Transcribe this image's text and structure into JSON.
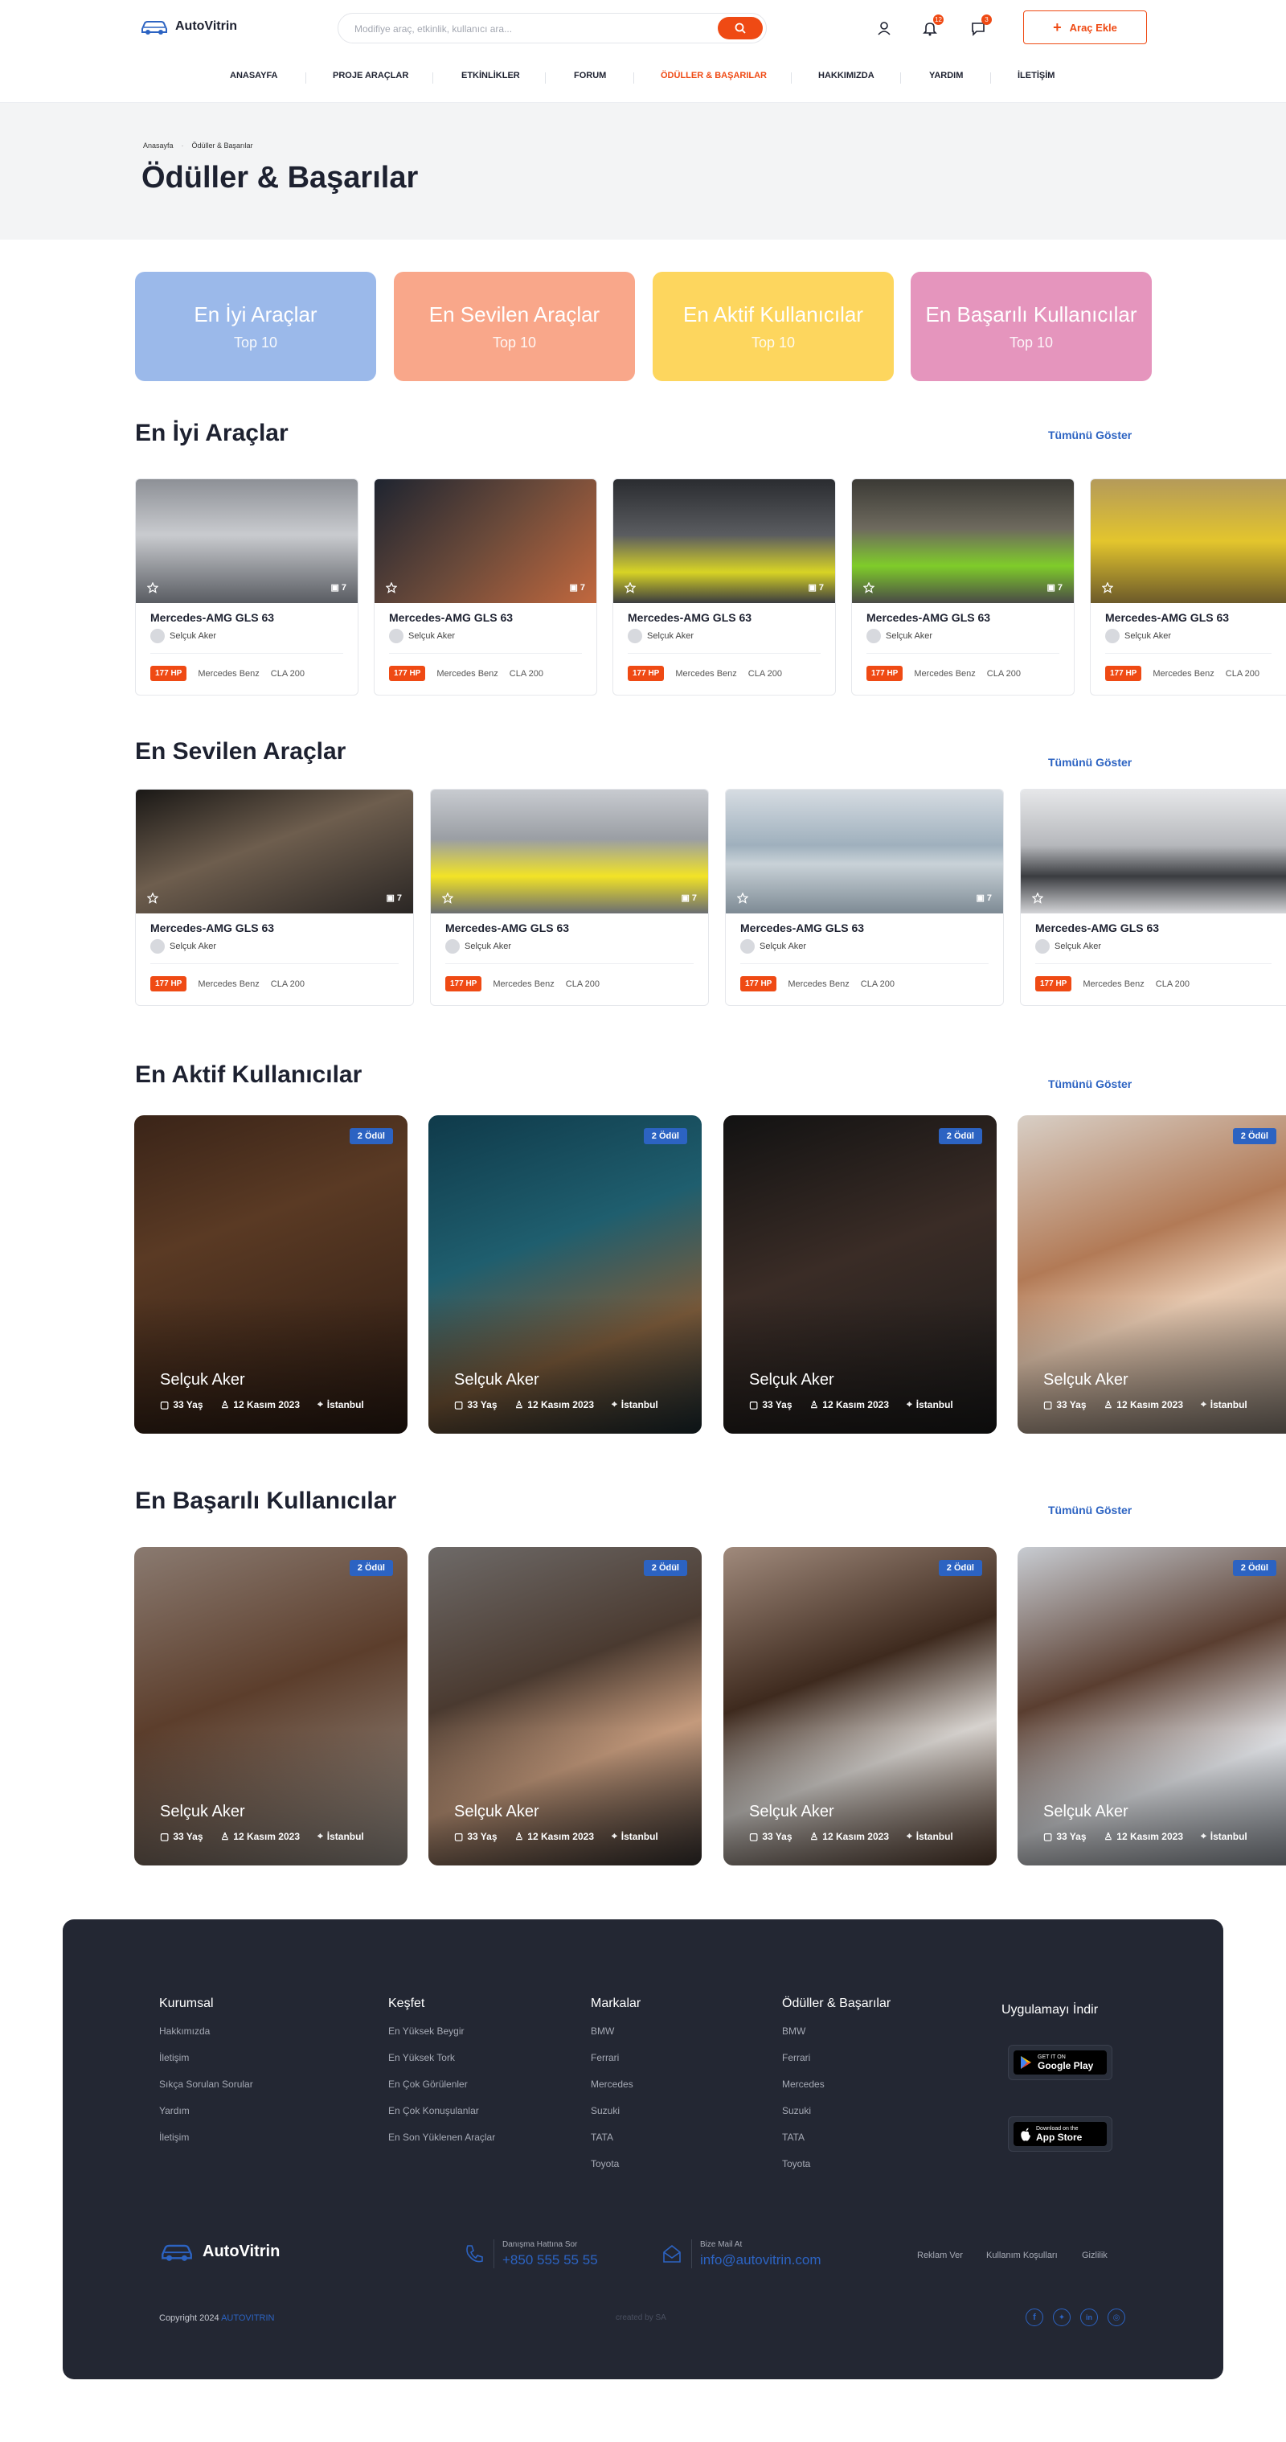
{
  "header": {
    "logo_text": "AutoVitrin",
    "search_placeholder": "Modifiye araç, etkinlik, kullanıcı ara...",
    "notifications_count": "12",
    "messages_count": "3",
    "add_button_label": "Araç Ekle"
  },
  "nav": {
    "items": [
      "ANASAYFA",
      "PROJE ARAÇLAR",
      "ETKİNLİKLER",
      "FORUM",
      "ÖDÜLLER & BAŞARILAR",
      "HAKKIMIZDA",
      "YARDIM",
      "İLETİŞİM"
    ],
    "active": "ÖDÜLLER & BAŞARILAR"
  },
  "hero": {
    "breadcrumb": [
      "Anasayfa",
      "Ödüller & Başarılar"
    ],
    "title": "Ödüller & Başarılar"
  },
  "tiles": [
    {
      "title": "En İyi Araçlar",
      "sub": "Top 10",
      "color": "#9bb9ea"
    },
    {
      "title": "En Sevilen Araçlar",
      "sub": "Top 10",
      "color": "#f9a78a"
    },
    {
      "title": "En Aktif Kullanıcılar",
      "sub": "Top 10",
      "color": "#fdd65e"
    },
    {
      "title": "En Başarılı Kullanıcılar",
      "sub": "Top 10",
      "color": "#e595bd"
    }
  ],
  "sections": {
    "best_cars": "En İyi Araçlar",
    "loved_cars": "En Sevilen Araçlar",
    "active_users": "En Aktif Kullanıcılar",
    "successful_users": "En Başarılı Kullanıcılar",
    "see_all": "Tümünü Göster"
  },
  "car": {
    "title": "Mercedes-AMG GLS 63",
    "owner": "Selçuk Aker",
    "photo_count": "7",
    "hp": "177 HP",
    "brand": "Mercedes Benz",
    "model": "CLA 200"
  },
  "user": {
    "award": "2 Ödül",
    "name": "Selçuk Aker",
    "age": "33 Yaş",
    "date": "12 Kasım 2023",
    "city": "İstanbul"
  },
  "footer": {
    "col1": {
      "title": "Kurumsal",
      "links": [
        "Hakkımızda",
        "İletişim",
        "Sıkça Sorulan Sorular",
        "Yardım",
        "İletişim"
      ]
    },
    "col2": {
      "title": "Keşfet",
      "links": [
        "En Yüksek Beygir",
        "En Yüksek Tork",
        "En Çok Görülenler",
        "En Çok Konuşulanlar",
        "En Son Yüklenen Araçlar"
      ]
    },
    "col3": {
      "title": "Markalar",
      "links": [
        "BMW",
        "Ferrari",
        "Mercedes",
        "Suzuki",
        "TATA",
        "Toyota"
      ]
    },
    "col4": {
      "title": "Ödüller & Başarılar",
      "links": [
        "BMW",
        "Ferrari",
        "Mercedes",
        "Suzuki",
        "TATA",
        "Toyota"
      ]
    },
    "app_title": "Uygulamayı İndir",
    "google_small": "GET IT ON",
    "google_big": "Google Play",
    "apple_small": "Download on the",
    "apple_big": "App Store",
    "logo_text": "AutoVitrin",
    "phone_label": "Danışma Hattına Sor",
    "phone": "+850 555 55 55",
    "mail_label": "Bize Mail At",
    "mail": "info@autovitrin.com",
    "legal": [
      "Reklam Ver",
      "Kullanım Koşulları",
      "Gizlilik"
    ],
    "copyright": "Copyright 2024",
    "brand": "AUTOVITRIN",
    "created": "created by SA"
  }
}
